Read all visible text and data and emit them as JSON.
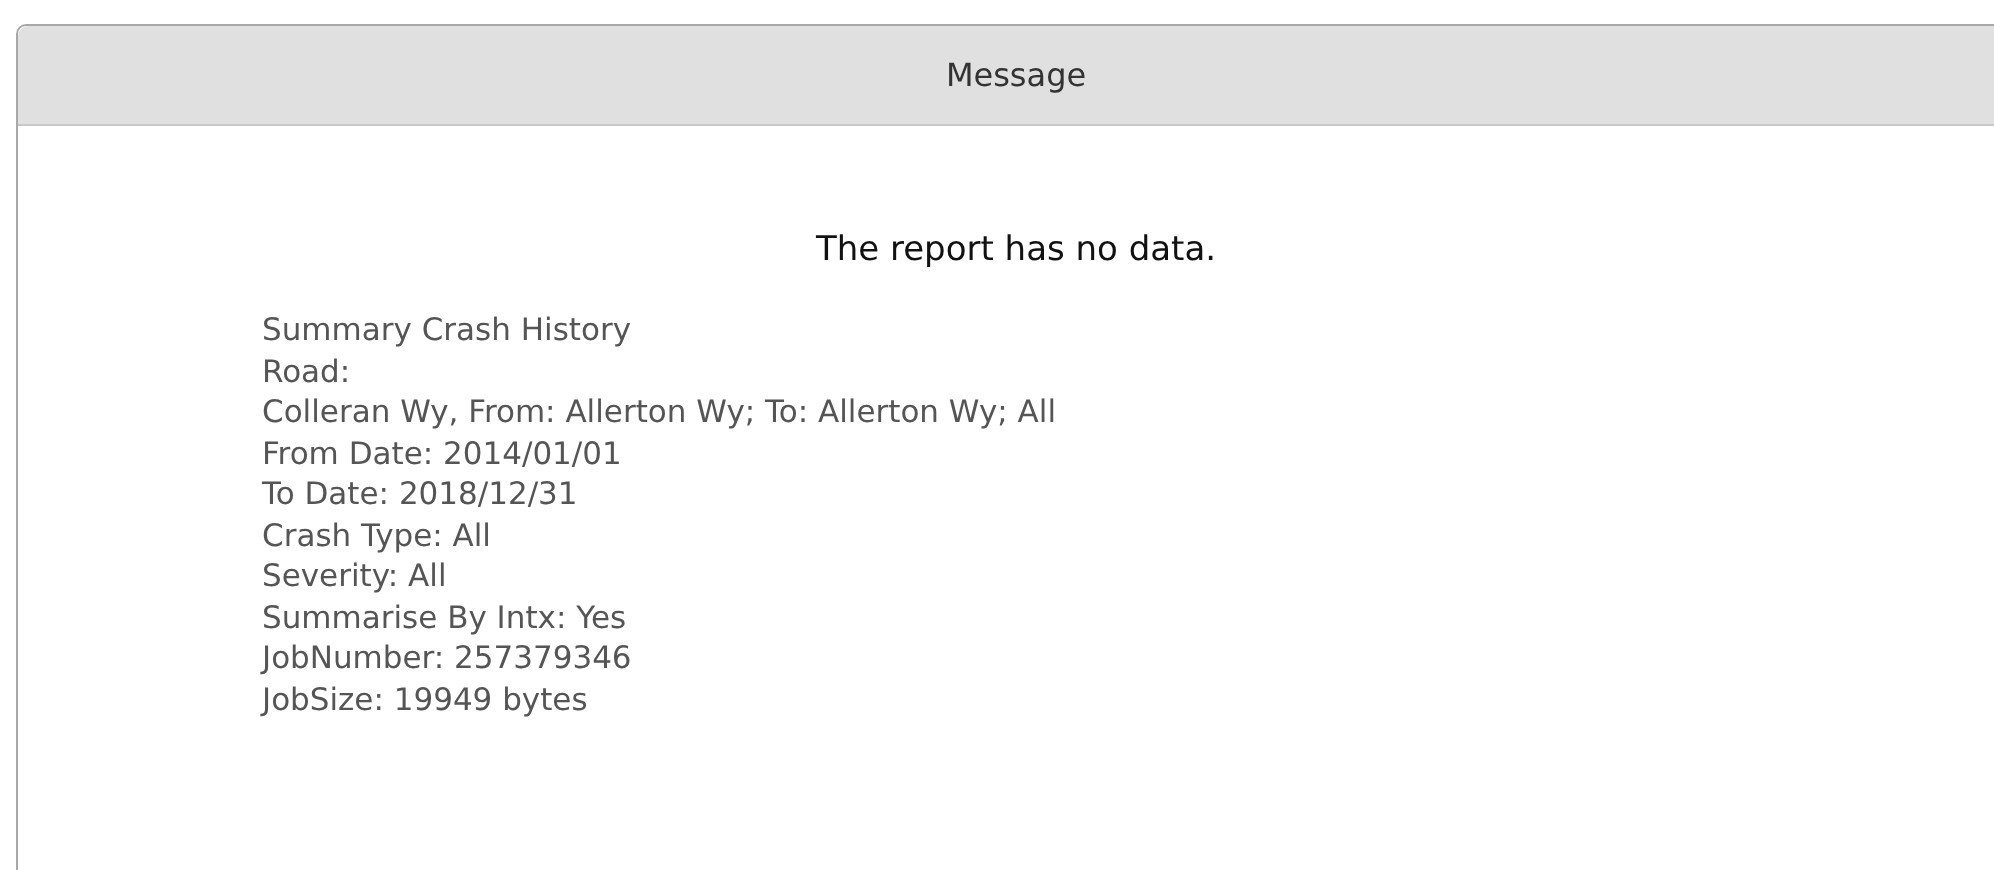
{
  "dialog": {
    "title": "Message",
    "message": "The report has no data.",
    "details": [
      "Summary Crash History",
      "Road:",
      "Colleran Wy, From: Allerton Wy; To: Allerton Wy; All",
      "From Date: 2014/01/01",
      "To Date: 2018/12/31",
      "Crash Type: All",
      "Severity: All",
      "Summarise By Intx: Yes",
      "JobNumber: 257379346",
      "JobSize: 19949 bytes"
    ]
  }
}
